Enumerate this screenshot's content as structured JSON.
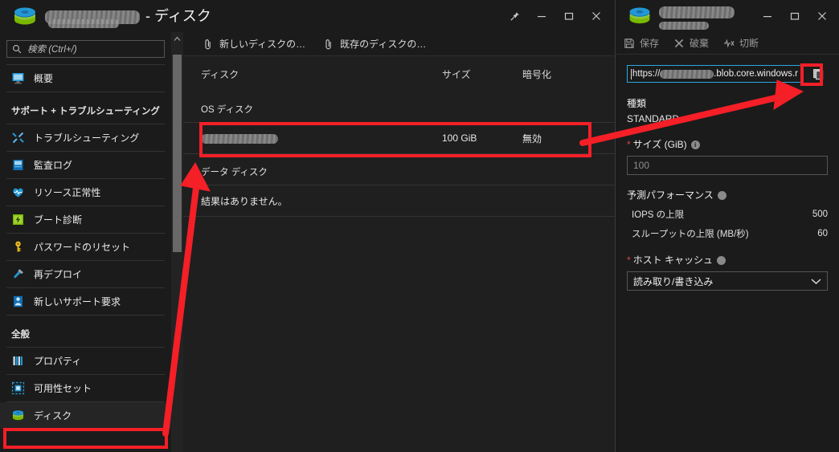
{
  "left_window": {
    "title_suffix": "- ディスク",
    "icon": "disk-icon",
    "window_buttons": [
      {
        "name": "pin-icon",
        "label": "ピン留め"
      },
      {
        "name": "minimize-icon",
        "label": "最小化"
      },
      {
        "name": "maximize-icon",
        "label": "最大化"
      },
      {
        "name": "close-icon",
        "label": "閉じる"
      }
    ],
    "toolbar": [
      {
        "name": "new-disk-button",
        "label": "新しいディスクの…",
        "icon": "attach-icon"
      },
      {
        "name": "existing-disk-button",
        "label": "既存のディスクの…",
        "icon": "attach-icon"
      }
    ],
    "search": {
      "placeholder": "検索 (Ctrl+/)",
      "value": "",
      "icon": "search-icon"
    },
    "sidebar": {
      "items": [
        {
          "label": "概要",
          "icon": "overview-icon",
          "type": "item",
          "selected": false
        },
        {
          "label": "サポート + トラブルシューティング",
          "type": "group"
        },
        {
          "label": "トラブルシューティング",
          "icon": "wrench-icon",
          "type": "item",
          "selected": false
        },
        {
          "label": "監査ログ",
          "icon": "book-icon",
          "type": "item",
          "selected": false
        },
        {
          "label": "リソース正常性",
          "icon": "heart-icon",
          "type": "item",
          "selected": false
        },
        {
          "label": "ブート診断",
          "icon": "boot-icon",
          "type": "item",
          "selected": false
        },
        {
          "label": "パスワードのリセット",
          "icon": "key-icon",
          "type": "item",
          "selected": false
        },
        {
          "label": "再デプロイ",
          "icon": "hammer-icon",
          "type": "item",
          "selected": false
        },
        {
          "label": "新しいサポート要求",
          "icon": "support-icon",
          "type": "item",
          "selected": false
        },
        {
          "label": "全般",
          "type": "group"
        },
        {
          "label": "プロパティ",
          "icon": "properties-icon",
          "type": "item",
          "selected": false
        },
        {
          "label": "可用性セット",
          "icon": "availability-set-icon",
          "type": "item",
          "selected": false
        },
        {
          "label": "ディスク",
          "icon": "disk-icon",
          "type": "item",
          "selected": true
        }
      ]
    },
    "main": {
      "columns": [
        {
          "key": "disk",
          "label": "ディスク"
        },
        {
          "key": "size",
          "label": "サイズ"
        },
        {
          "key": "encryption",
          "label": "暗号化"
        }
      ],
      "os_disk": {
        "section_label": "OS ディスク",
        "rows": [
          {
            "disk": "",
            "disk_redacted": true,
            "size": "100 GiB",
            "encryption": "無効"
          }
        ]
      },
      "data_disk": {
        "section_label": "データ ディスク",
        "empty_message": "結果はありません。"
      }
    }
  },
  "right_panel": {
    "icon": "disk-icon",
    "window_buttons": [
      {
        "name": "minimize-icon",
        "label": "最小化"
      },
      {
        "name": "maximize-icon",
        "label": "最大化"
      },
      {
        "name": "close-icon",
        "label": "閉じる"
      }
    ],
    "toolbar": [
      {
        "name": "save-button",
        "label": "保存",
        "icon": "save-icon",
        "enabled": false
      },
      {
        "name": "discard-button",
        "label": "破棄",
        "icon": "x-icon",
        "enabled": false
      },
      {
        "name": "disconnect-button",
        "label": "切断",
        "icon": "disconnect-icon",
        "enabled": false
      }
    ],
    "url_field": {
      "prefix": "https://",
      "suffix": ".blob.core.windows.r",
      "focused": true
    },
    "copy_button": {
      "name": "copy-button",
      "icon": "copy-icon"
    },
    "fields": {
      "type_label": "種類",
      "type_value": "STANDARD",
      "size_label": "サイズ (GiB)",
      "size_value": "100",
      "size_required": true,
      "perf_label": "予測パフォーマンス",
      "perf_rows": [
        {
          "label": "IOPS の上限",
          "value": "500"
        },
        {
          "label": "スループットの上限 (MB/秒)",
          "value": "60"
        }
      ],
      "cache_label": "ホスト キャッシュ",
      "cache_required": true,
      "cache_value": "読み取り/書き込み"
    }
  },
  "annotations": {
    "highlight_color": "#f41f27",
    "boxes": [
      {
        "name": "os-disk-row-highlight"
      },
      {
        "name": "disks-nav-highlight"
      },
      {
        "name": "copy-button-highlight"
      }
    ],
    "arrows": [
      {
        "name": "arrow-nav-to-row"
      },
      {
        "name": "arrow-row-to-copy"
      }
    ]
  }
}
